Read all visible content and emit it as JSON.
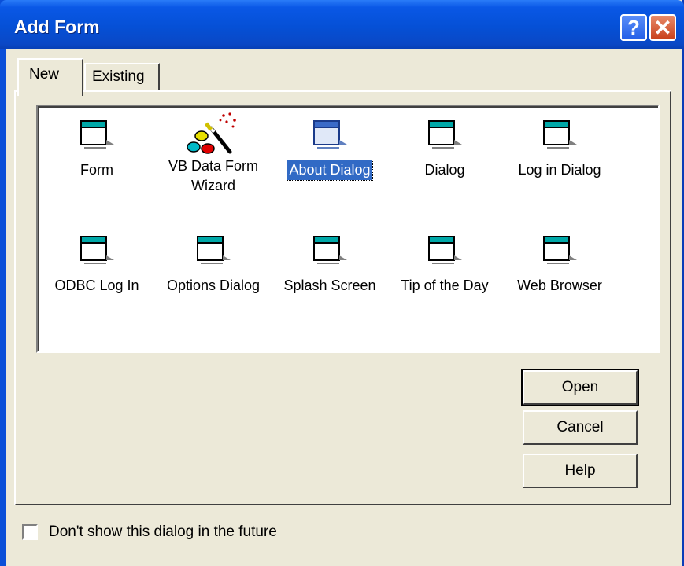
{
  "window": {
    "title": "Add Form",
    "help_glyph": "?",
    "close_glyph": "✕"
  },
  "tabs": [
    {
      "label": "New",
      "active": true
    },
    {
      "label": "Existing",
      "active": false
    }
  ],
  "items": [
    {
      "label": "Form",
      "icon": "form-icon"
    },
    {
      "label": "VB Data Form\nWizard",
      "icon": "wizard-icon"
    },
    {
      "label": "About Dialog",
      "icon": "form-icon",
      "selected": true
    },
    {
      "label": "Dialog",
      "icon": "form-icon"
    },
    {
      "label": "Log in Dialog",
      "icon": "form-icon"
    },
    {
      "label": "ODBC Log In",
      "icon": "form-icon"
    },
    {
      "label": "Options Dialog",
      "icon": "form-icon"
    },
    {
      "label": "Splash Screen",
      "icon": "form-icon"
    },
    {
      "label": "Tip of the Day",
      "icon": "form-icon"
    },
    {
      "label": "Web Browser",
      "icon": "form-icon"
    }
  ],
  "buttons": {
    "open": "Open",
    "cancel": "Cancel",
    "help": "Help"
  },
  "checkbox": {
    "label": "Don't show this dialog in the future",
    "checked": false
  },
  "colors": {
    "selection": "#316ac5",
    "titlebar": "#0550d6",
    "face": "#ece9d8"
  }
}
